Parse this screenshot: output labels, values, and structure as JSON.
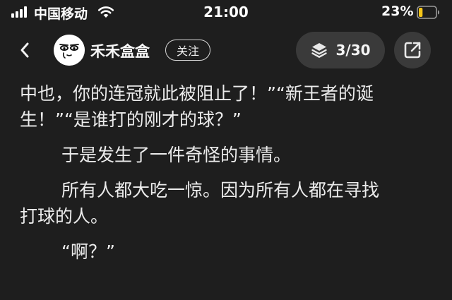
{
  "status_bar": {
    "carrier": "中国移动",
    "time": "21:00",
    "battery_percent": "23%",
    "battery_level": 0.23,
    "icons": [
      "signal-icon",
      "wifi-icon",
      "battery-icon"
    ]
  },
  "header": {
    "author_name": "禾禾盒盒",
    "follow_label": "关注",
    "chapter_count": "3/30",
    "icons": [
      "back-arrow-icon",
      "avatar-cartoon-face",
      "layers-icon",
      "share-icon"
    ]
  },
  "content": {
    "paragraphs": [
      {
        "lines": [
          "中也，你的连冠就此被阻止了！”“新王者的诞",
          "生！”“是谁打的刚才的球？”"
        ],
        "indent": false
      },
      {
        "lines": [
          "于是发生了一件奇怪的事情。"
        ],
        "indent": true
      },
      {
        "lines": [
          "所有人都大吃一惊。因为所有人都在寻找",
          "打球的人。"
        ],
        "indent": true
      },
      {
        "lines": [
          "“啊？”"
        ],
        "indent": true
      }
    ]
  },
  "colors": {
    "background": "#1e1e1e",
    "text": "#ececec",
    "pill": "#3a3a3a",
    "battery_fill": "#f5c518"
  }
}
